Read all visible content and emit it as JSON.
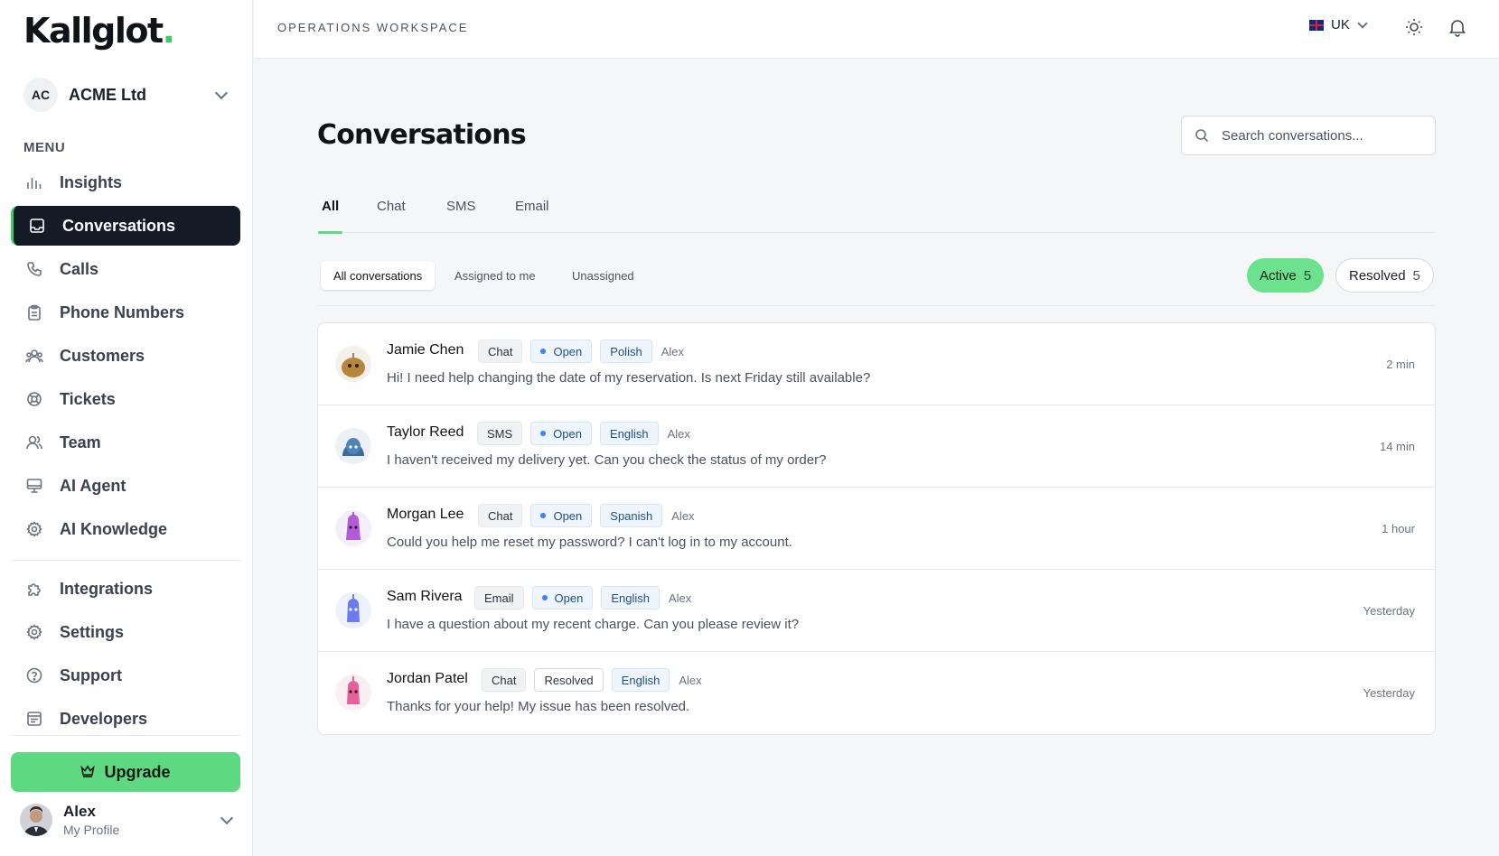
{
  "app": {
    "logo": "Kallglot",
    "logo_dot": "."
  },
  "org": {
    "initials": "AC",
    "name": "ACME Ltd"
  },
  "sidebar": {
    "menu_label": "MENU",
    "items": [
      {
        "label": "Insights",
        "icon": "bar-chart-icon"
      },
      {
        "label": "Conversations",
        "icon": "inbox-icon",
        "active": true
      },
      {
        "label": "Calls",
        "icon": "phone-icon"
      },
      {
        "label": "Phone Numbers",
        "icon": "clipboard-icon"
      },
      {
        "label": "Customers",
        "icon": "users-icon"
      },
      {
        "label": "Tickets",
        "icon": "lifebuoy-icon"
      },
      {
        "label": "Team",
        "icon": "team-icon"
      },
      {
        "label": "AI Agent",
        "icon": "monitor-icon"
      },
      {
        "label": "AI Knowledge",
        "icon": "gear-icon"
      }
    ],
    "secondary": [
      {
        "label": "Integrations",
        "icon": "puzzle-icon"
      },
      {
        "label": "Settings",
        "icon": "settings-icon"
      },
      {
        "label": "Support",
        "icon": "help-icon"
      },
      {
        "label": "Developers",
        "icon": "code-window-icon"
      }
    ],
    "upgrade_label": "Upgrade",
    "profile": {
      "name": "Alex",
      "subtitle": "My Profile"
    }
  },
  "topbar": {
    "workspace": "OPERATIONS WORKSPACE",
    "locale": "UK"
  },
  "main": {
    "title": "Conversations",
    "search_placeholder": "Search conversations...",
    "tabs": [
      "All",
      "Chat",
      "SMS",
      "Email"
    ],
    "segments": [
      "All conversations",
      "Assigned to me",
      "Unassigned"
    ],
    "pills": [
      {
        "label": "Active",
        "count": "5"
      },
      {
        "label": "Resolved",
        "count": "5"
      }
    ],
    "conversations": [
      {
        "name": "Jamie Chen",
        "channel": "Chat",
        "status": "Open",
        "language": "Polish",
        "agent": "Alex",
        "message": "Hi! I need help changing the date of my reservation. Is next Friday still available?",
        "time": "2 min",
        "avatar_color": "#b8863b"
      },
      {
        "name": "Taylor Reed",
        "channel": "SMS",
        "status": "Open",
        "language": "English",
        "agent": "Alex",
        "message": "I haven't received my delivery yet. Can you check the status of my order?",
        "time": "14 min",
        "avatar_color": "#3a6a9a"
      },
      {
        "name": "Morgan Lee",
        "channel": "Chat",
        "status": "Open",
        "language": "Spanish",
        "agent": "Alex",
        "message": "Could you help me reset my password? I can't log in to my account.",
        "time": "1 hour",
        "avatar_color": "#b25ad8"
      },
      {
        "name": "Sam Rivera",
        "channel": "Email",
        "status": "Open",
        "language": "English",
        "agent": "Alex",
        "message": "I have a question about my recent charge. Can you please review it?",
        "time": "Yesterday",
        "avatar_color": "#6b7cf0"
      },
      {
        "name": "Jordan Patel",
        "channel": "Chat",
        "status": "Resolved",
        "language": "English",
        "agent": "Alex",
        "message": "Thanks for your help! My issue has been resolved.",
        "time": "Yesterday",
        "avatar_color": "#e8609a"
      }
    ]
  },
  "colors": {
    "accent": "#5fd882",
    "nav_active": "#141a26",
    "status_blue": "#3b82f6"
  }
}
